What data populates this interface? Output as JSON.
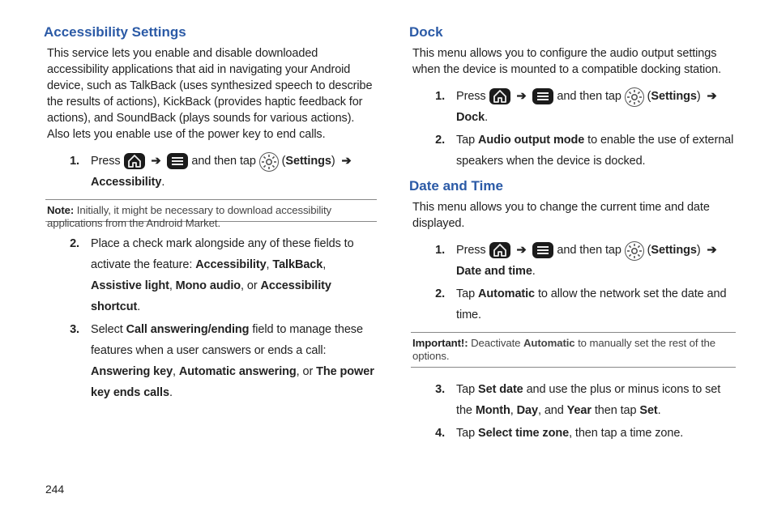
{
  "page_number": "244",
  "arrow_glyph": "➔",
  "icons": {
    "home": "home-icon",
    "menu": "menu-icon",
    "gear": "gear-icon"
  },
  "left": {
    "section_title": "Accessibility Settings",
    "intro": "This service lets you enable and disable downloaded accessibility applications that aid in navigating your Android device, such as TalkBack (uses synthesized speech to describe the results of actions), KickBack (provides haptic feedback for actions), and SoundBack (plays sounds for various actions). Also lets you enable use of the power key to end calls.",
    "step1": {
      "pre": "Press ",
      "mid": " and then tap ",
      "settings_label": "Settings",
      "tail": "Accessibility",
      "tail_suffix": "."
    },
    "note": {
      "tag": "Note:",
      "text": "Initially, it might be necessary to download accessibility applications from the Android Market."
    },
    "step2": {
      "pre": "Place a check mark alongside any of these fields to activate the feature: ",
      "f1": "Accessibility",
      "f2": "TalkBack",
      "f3": "Assistive light",
      "f4": "Mono audio",
      "f5": "Accessibility shortcut",
      "suffix": "."
    },
    "step3": {
      "pre": "Select ",
      "field": "Call answering/ending",
      "mid": " field to manage these features when a user canswers or ends a call: ",
      "o1": "Answering key",
      "o2": "Automatic answering",
      "o3": "The power key ends calls",
      "suffix": "."
    }
  },
  "right": {
    "dock_title": "Dock",
    "dock_intro": "This menu allows you to configure the audio output settings when the device is mounted to a compatible docking station.",
    "dock_step1": {
      "pre": "Press ",
      "mid": " and then tap ",
      "settings_label": "Settings",
      "tail": "Dock",
      "tail_suffix": "."
    },
    "dock_step2": {
      "pre": "Tap ",
      "bold": "Audio output mode",
      "post": " to enable the use of external speakers when the device is docked."
    },
    "date_title": "Date and Time",
    "date_intro": "This menu allows you to change the current time and date displayed.",
    "date_step1": {
      "pre": "Press ",
      "mid": " and then tap ",
      "settings_label": "Settings",
      "tail": "Date and time",
      "tail_suffix": "."
    },
    "date_step2": {
      "pre": "Tap ",
      "bold": "Automatic",
      "post": " to allow the network set the date and time."
    },
    "important": {
      "tag": "Important!:",
      "pre": "Deactivate ",
      "bold": "Automatic",
      "post": " to manually set the rest of the options."
    },
    "date_step3": {
      "pre": "Tap ",
      "b1": "Set date",
      "mid1": " and use the plus or minus icons to set the ",
      "b2": "Month",
      "sep": ", ",
      "b3": "Day",
      "and": ", and ",
      "b4": "Year",
      "mid2": " then tap ",
      "b5": "Set",
      "suffix": "."
    },
    "date_step4": {
      "pre": "Tap ",
      "bold": "Select time zone",
      "post": ", then tap a time zone."
    }
  }
}
